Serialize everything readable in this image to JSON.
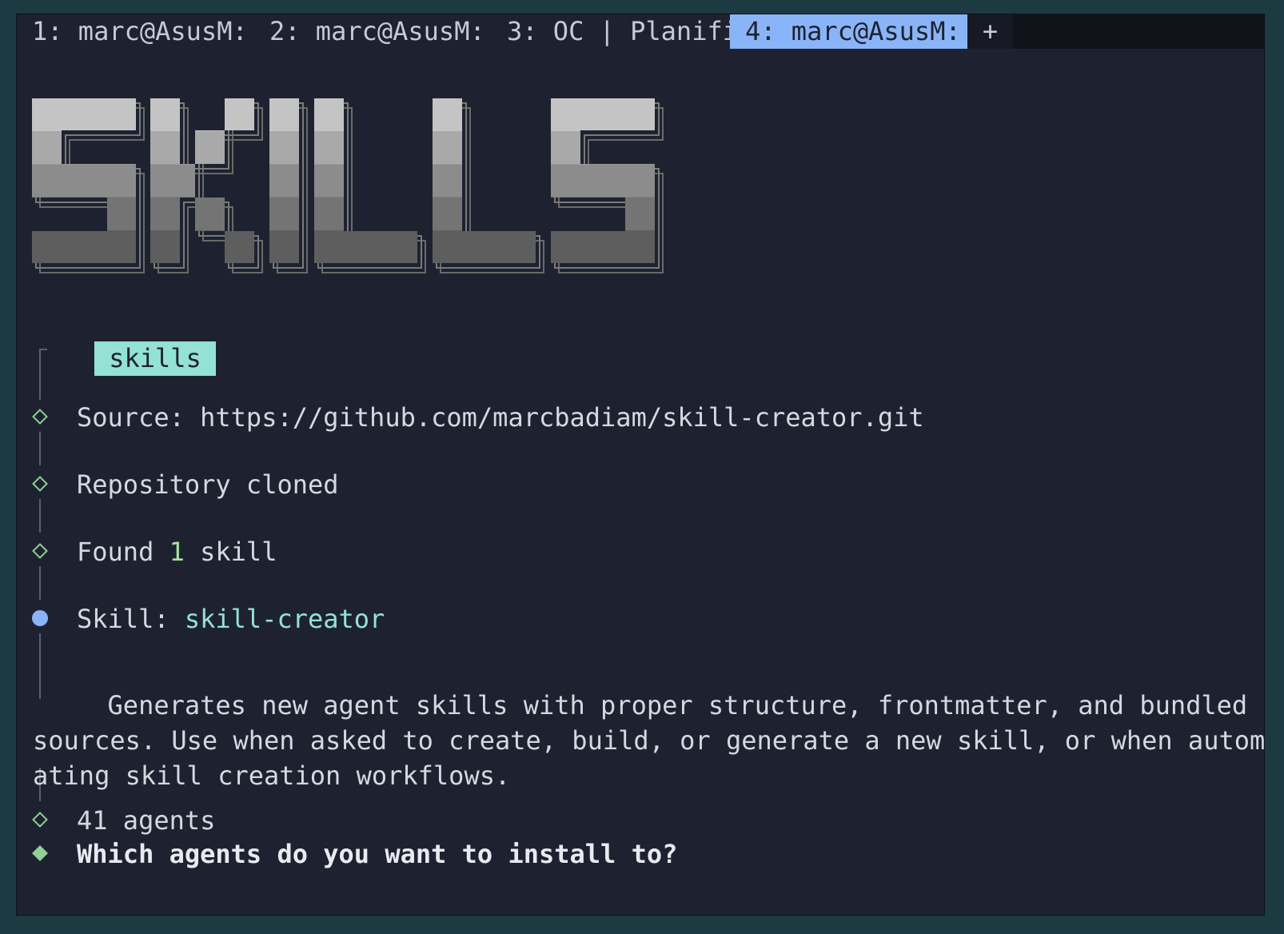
{
  "tabs": [
    {
      "label": "1: marc@AsusM:"
    },
    {
      "label": "2: marc@AsusM:"
    },
    {
      "label": "3: OC | Planifi"
    },
    {
      "label": "4: marc@AsusM:"
    },
    {
      "label": "+"
    }
  ],
  "banner": {
    "text": "SKILLS"
  },
  "badge": {
    "label": "skills"
  },
  "steps": {
    "source_prefix": "Source: ",
    "source_url": "https://github.com/marcbadiam/skill-creator.git",
    "cloned": "Repository cloned",
    "found_prefix": "Found ",
    "found_count": "1",
    "found_suffix": " skill",
    "skill_prefix": "Skill: ",
    "skill_name": "skill-creator",
    "description_lines": [
      "  Generates new agent skills with proper structure, frontmatter, and bundled re",
      "sources. Use when asked to create, build, or generate a new skill, or when autom",
      "ating skill creation workflows."
    ],
    "agents": "41 agents",
    "prompt": "Which agents do you want to install to?"
  },
  "colors": {
    "background": "#1e2230",
    "active_tab": "#8ab4f8",
    "accent_green": "#8fd094",
    "accent_teal": "#94e2d5",
    "current_step": "#8ab4f8"
  }
}
